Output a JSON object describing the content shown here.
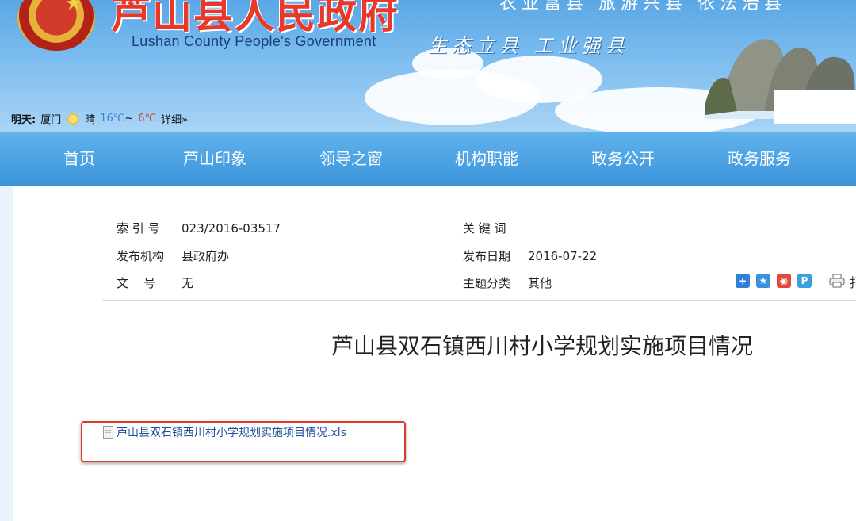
{
  "header": {
    "title": "芦山县人民政府",
    "subtitle_en": "Lushan County People's Government",
    "slogan": "生态立县  工业强县",
    "slogan_top": "农业富县  旅游兴县  依法治县"
  },
  "weather": {
    "label": "明天:",
    "city": "厦门",
    "condition": "晴",
    "low": "16℃",
    "sep": "~",
    "high": "6℃",
    "detail": "详细»"
  },
  "nav": {
    "items": [
      "首页",
      "芦山印象",
      "领导之窗",
      "机构职能",
      "政务公开",
      "政务服务"
    ]
  },
  "meta": {
    "index_label": "索 引 号",
    "index_value": "023/2016-03517",
    "keyword_label": "关 键 词",
    "keyword_value": "",
    "publisher_label": "发布机构",
    "publisher_value": "县政府办",
    "date_label": "发布日期",
    "date_value": "2016-07-22",
    "docno_label": "文    号",
    "docno_value": "无",
    "topic_label": "主题分类",
    "topic_value": "其他"
  },
  "share": {
    "print_label": "打"
  },
  "article": {
    "title": "芦山县双石镇西川村小学规划实施项目情况",
    "attachment": "芦山县双石镇西川村小学规划实施项目情况.xls"
  },
  "colors": {
    "nav": "#3a93da",
    "title_red": "#e8382a",
    "link": "#1c4f9c",
    "highlight": "#dd3b2e"
  }
}
